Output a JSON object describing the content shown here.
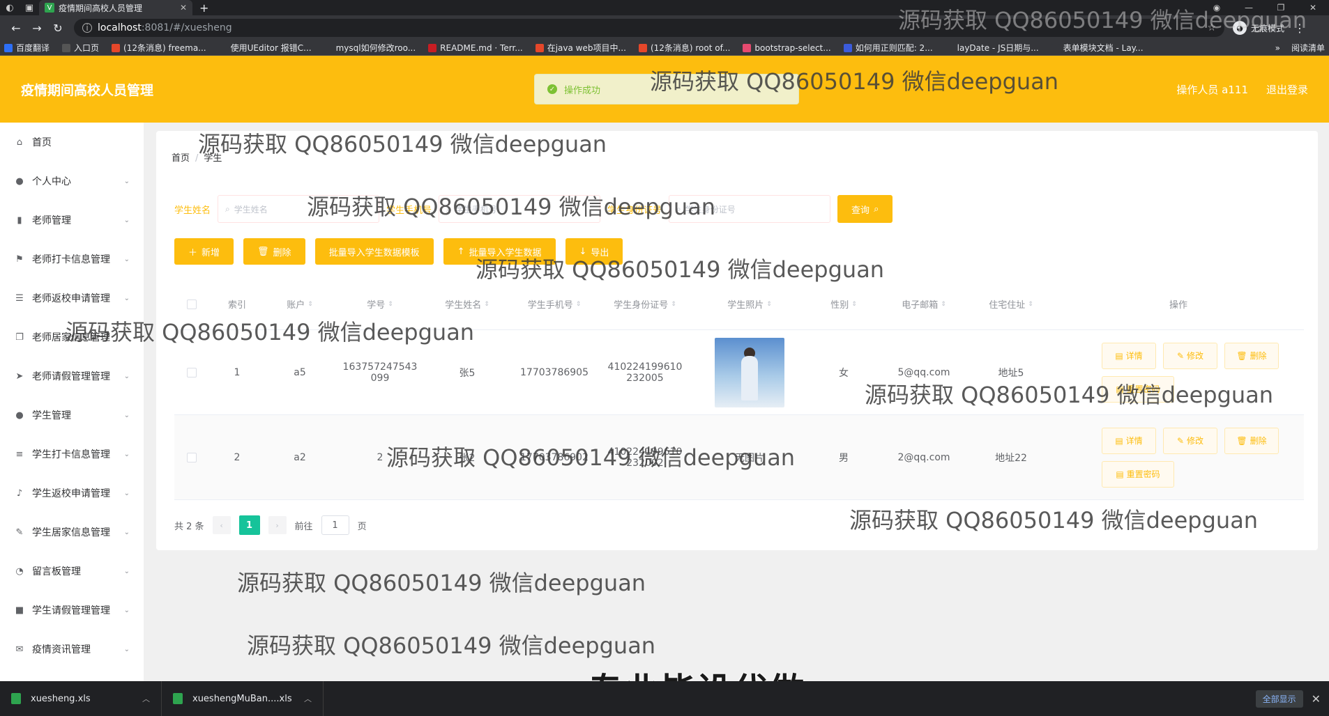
{
  "browser": {
    "tab_title": "疫情期间高校人员管理",
    "url_host": "localhost",
    "url_path": ":8081/#/xuesheng",
    "incognito_label": "无痕模式",
    "bookmarks": [
      {
        "label": "百度翻译",
        "color": "#2d6ff7"
      },
      {
        "label": "入口页",
        "color": "#555555"
      },
      {
        "label": "(12条消息) freema...",
        "color": "#e5472a"
      },
      {
        "label": "使用UEditor 报错C...",
        "color": "#35363a"
      },
      {
        "label": "mysql如何修改roo...",
        "color": "#35363a"
      },
      {
        "label": "README.md · Terr...",
        "color": "#c71d23"
      },
      {
        "label": "在java web项目中...",
        "color": "#e5472a"
      },
      {
        "label": "(12条消息) root of...",
        "color": "#e5472a"
      },
      {
        "label": "bootstrap-select...",
        "color": "#e64a6f"
      },
      {
        "label": "如何用正则匹配: 2...",
        "color": "#3b5bdb"
      },
      {
        "label": "layDate - JS日期与...",
        "color": "#35363a"
      },
      {
        "label": "表单模块文档 - Lay...",
        "color": "#35363a"
      }
    ],
    "reading_list": "阅读清单"
  },
  "header": {
    "title": "疫情期间高校人员管理",
    "operator": "操作人员 a111",
    "logout": "退出登录",
    "toast": "操作成功"
  },
  "sidebar": {
    "items": [
      {
        "label": "首页",
        "icon": "home-icon",
        "glyph": "⌂",
        "chevron": false
      },
      {
        "label": "个人中心",
        "icon": "user-icon",
        "glyph": "●",
        "chevron": true
      },
      {
        "label": "老师管理",
        "icon": "chart-icon",
        "glyph": "▮",
        "chevron": true
      },
      {
        "label": "老师打卡信息管理",
        "icon": "flag-icon",
        "glyph": "⚑",
        "chevron": true
      },
      {
        "label": "老师返校申请管理",
        "icon": "list-icon",
        "glyph": "☰",
        "chevron": true
      },
      {
        "label": "老师居家信息管理",
        "icon": "copy-icon",
        "glyph": "❐",
        "chevron": true
      },
      {
        "label": "老师请假管理管理",
        "icon": "send-icon",
        "glyph": "➤",
        "chevron": true
      },
      {
        "label": "学生管理",
        "icon": "user-icon",
        "glyph": "●",
        "chevron": true
      },
      {
        "label": "学生打卡信息管理",
        "icon": "list-icon",
        "glyph": "≡",
        "chevron": true
      },
      {
        "label": "学生返校申请管理",
        "icon": "mic-icon",
        "glyph": "♪",
        "chevron": true
      },
      {
        "label": "学生居家信息管理",
        "icon": "pen-icon",
        "glyph": "✎",
        "chevron": true
      },
      {
        "label": "留言板管理",
        "icon": "compass-icon",
        "glyph": "◔",
        "chevron": true
      },
      {
        "label": "学生请假管理管理",
        "icon": "camera-icon",
        "glyph": "■",
        "chevron": true
      },
      {
        "label": "疫情资讯管理",
        "icon": "mail-icon",
        "glyph": "✉",
        "chevron": true
      }
    ]
  },
  "breadcrumb": {
    "home": "首页",
    "current": "学生"
  },
  "search": {
    "name_label": "学生姓名",
    "name_placeholder": "学生姓名",
    "phone_label": "学生手机号",
    "phone_placeholder": "学生手机号",
    "id_label": "学生身份证号",
    "id_placeholder": "学生身份证号",
    "query_button": "查询"
  },
  "actions": {
    "add": "新增",
    "delete": "删除",
    "import_template": "批量导入学生数据模板",
    "import_data": "批量导入学生数据",
    "export": "导出"
  },
  "table": {
    "headers": [
      "索引",
      "账户",
      "学号",
      "学生姓名",
      "学生手机号",
      "学生身份证号",
      "学生照片",
      "性别",
      "电子邮箱",
      "住宅住址",
      "操作"
    ],
    "rows": [
      {
        "index": "1",
        "account": "a5",
        "student_no": "163757247543 099",
        "name": "张5",
        "phone": "17703786905",
        "id_card": "410224199610 232005",
        "photo": "",
        "gender": "女",
        "email": "5@qq.com",
        "address": "地址5"
      },
      {
        "index": "2",
        "account": "a2",
        "student_no": "2",
        "name": "张2",
        "phone": "17703786902",
        "id_card": "410224199610 232002",
        "photo": "无图片",
        "gender": "男",
        "email": "2@qq.com",
        "address": "地址22"
      }
    ],
    "ops": {
      "detail": "详情",
      "edit": "修改",
      "delete": "删除",
      "reset": "重置密码"
    }
  },
  "pager": {
    "total": "共 2 条",
    "current": "1",
    "goto": "前往",
    "page_value": "1",
    "page_unit": "页"
  },
  "watermark": "源码获取 QQ86050149 微信deepguan",
  "caption": "专业毕设代做",
  "downloads": {
    "file1": "xuesheng.xls",
    "file2": "xueshengMuBan....xls",
    "show_all": "全部显示"
  }
}
